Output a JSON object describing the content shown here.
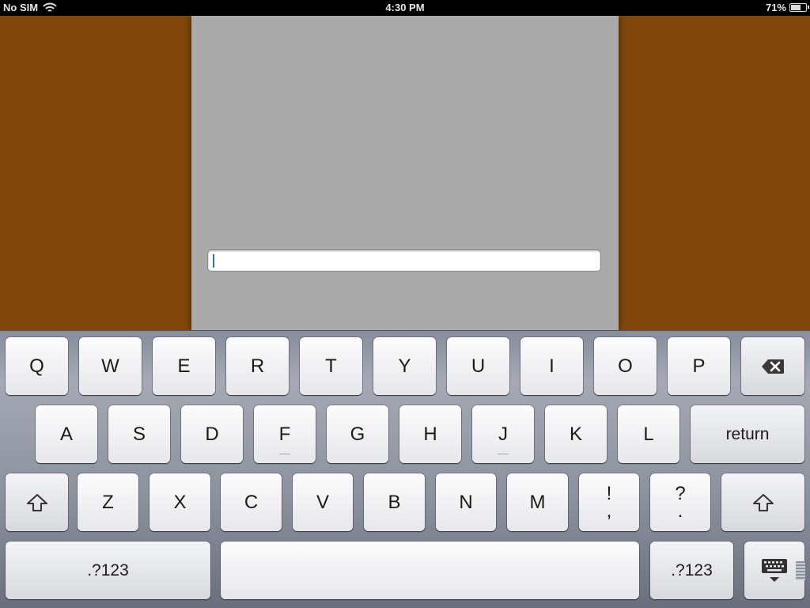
{
  "status_bar": {
    "carrier": "No SIM",
    "time": "4:30 PM",
    "battery_percent": "71%",
    "battery_level": 0.71
  },
  "text_field": {
    "value": "",
    "focused": true
  },
  "keyboard": {
    "row1": [
      "Q",
      "W",
      "E",
      "R",
      "T",
      "Y",
      "U",
      "I",
      "O",
      "P"
    ],
    "row2": [
      "A",
      "S",
      "D",
      "F",
      "G",
      "H",
      "J",
      "K",
      "L"
    ],
    "return_label": "return",
    "row3": [
      "Z",
      "X",
      "C",
      "V",
      "B",
      "N",
      "M"
    ],
    "punct1_top": "!",
    "punct1_bottom": ",",
    "punct2_top": "?",
    "punct2_bottom": ".",
    "numbers_label": ".?123",
    "icons": {
      "backspace": "backspace-icon",
      "shift": "shift-icon",
      "dismiss": "keyboard-dismiss-icon"
    }
  },
  "colors": {
    "background": "#81470a",
    "panel": "#aaaaaa",
    "caret": "#3a6bd9"
  }
}
